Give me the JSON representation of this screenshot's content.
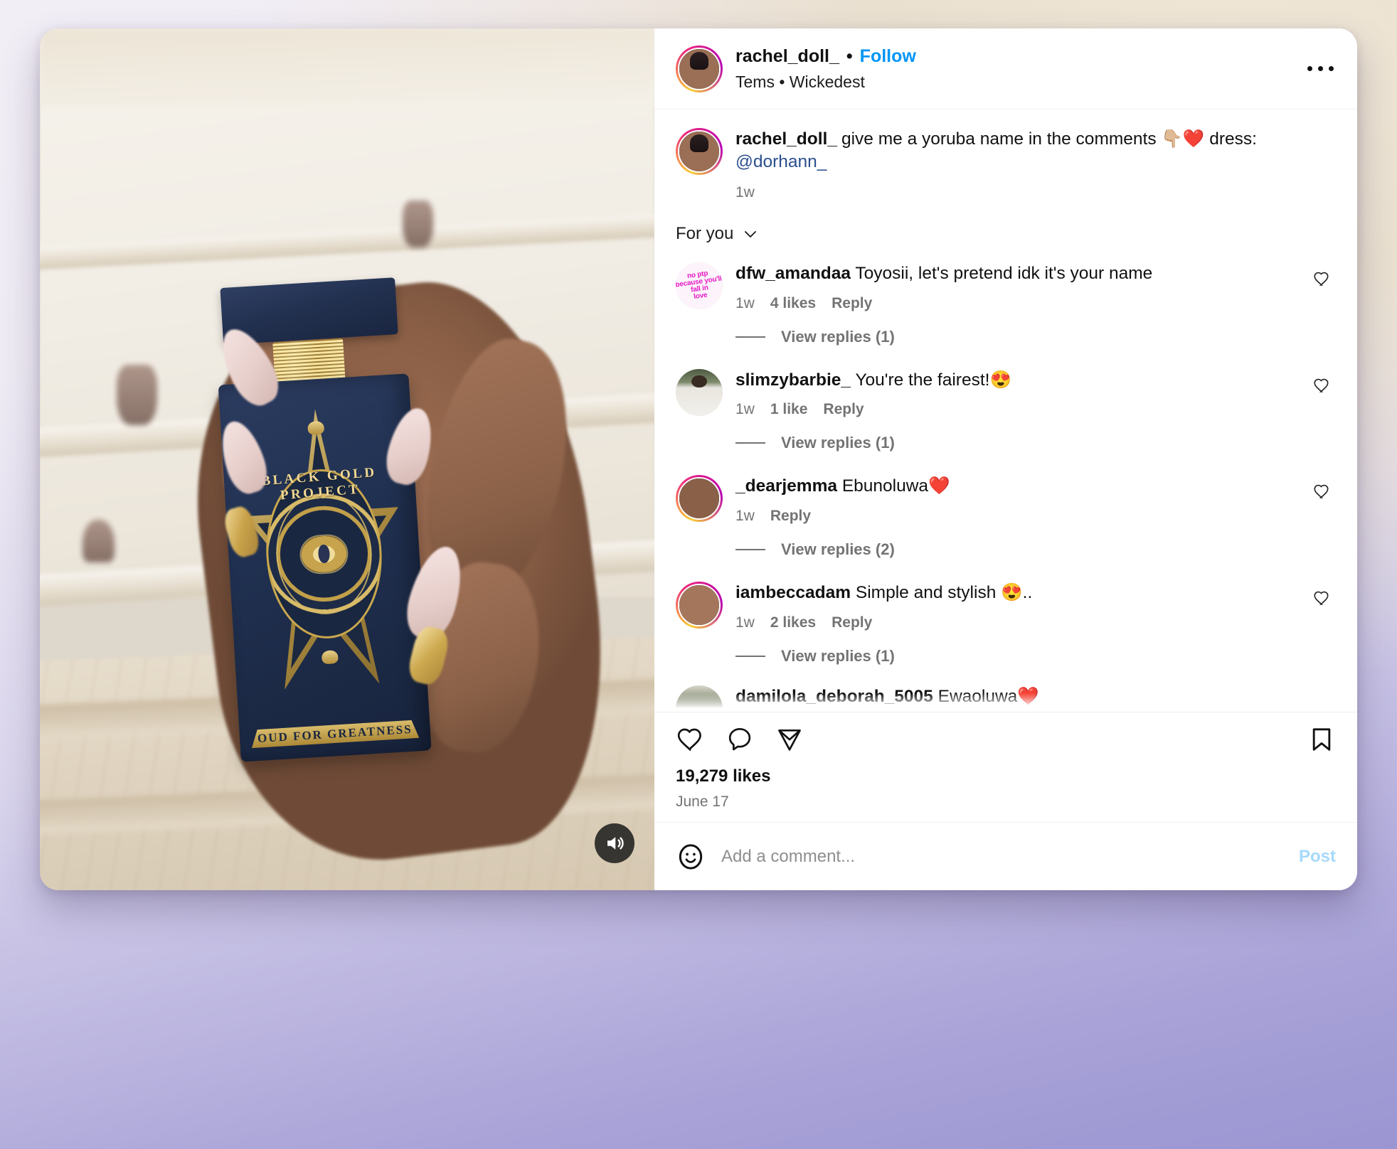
{
  "post": {
    "header": {
      "username": "rachel_doll_",
      "separator": "•",
      "follow_label": "Follow",
      "audio_attribution": "Tems • Wickedest",
      "more_icon": "ellipsis-icon"
    },
    "caption": {
      "username": "rachel_doll_",
      "text_before_mention": "give me a yoruba name in the comments 👇🏼❤️ dress: ",
      "mention": "@dorhann_",
      "timestamp": "1w"
    },
    "comments_filter": {
      "label": "For you",
      "chevron_icon": "chevron-down-icon"
    },
    "comments": [
      {
        "username": "dfw_amandaa",
        "text": "Toyosii, let's pretend idk it's your name",
        "timestamp": "1w",
        "likes": "4 likes",
        "reply_label": "Reply",
        "view_replies": "View replies (1)",
        "avatar": "avatar-dfw-amandaa",
        "avatar_text": "no ptp because you'll fall in love",
        "has_story_ring": false
      },
      {
        "username": "slimzybarbie_",
        "text": "You're the fairest!😍",
        "timestamp": "1w",
        "likes": "1 like",
        "reply_label": "Reply",
        "view_replies": "View replies (1)",
        "avatar": "avatar-slimzybarbie",
        "has_story_ring": false
      },
      {
        "username": "_dearjemma",
        "text": "Ebunoluwa❤️",
        "timestamp": "1w",
        "likes": "",
        "reply_label": "Reply",
        "view_replies": "View replies (2)",
        "avatar": "avatar-dearjemma",
        "has_story_ring": true
      },
      {
        "username": "iambeccadam",
        "text": "Simple and stylish 😍..",
        "timestamp": "1w",
        "likes": "2 likes",
        "reply_label": "Reply",
        "view_replies": "View replies (1)",
        "avatar": "avatar-iambeccadam",
        "has_story_ring": true
      }
    ],
    "partial_comment": {
      "username": "damilola_deborah_5005",
      "text": "Ewaoluwa❤️",
      "avatar": "avatar-damilola"
    },
    "actions": {
      "like_icon": "heart-icon",
      "comment_icon": "speech-bubble-icon",
      "share_icon": "paper-plane-icon",
      "save_icon": "bookmark-icon",
      "likes_count": "19,279 likes",
      "date": "June 17"
    },
    "add_comment": {
      "emoji_icon": "smiley-face-icon",
      "placeholder": "Add a comment...",
      "value": "",
      "post_label": "Post"
    },
    "media": {
      "type": "video-reel",
      "audio_icon": "speaker-on-icon",
      "bottle_brand": "BLACK GOLD PROJECT",
      "bottle_tagline": "OUD FOR GREATNESS"
    }
  },
  "colors": {
    "accent_blue": "#0095f6",
    "text_primary": "#111111",
    "text_secondary": "#737373",
    "mention_blue": "#2b4f8e",
    "card_white": "#ffffff"
  }
}
